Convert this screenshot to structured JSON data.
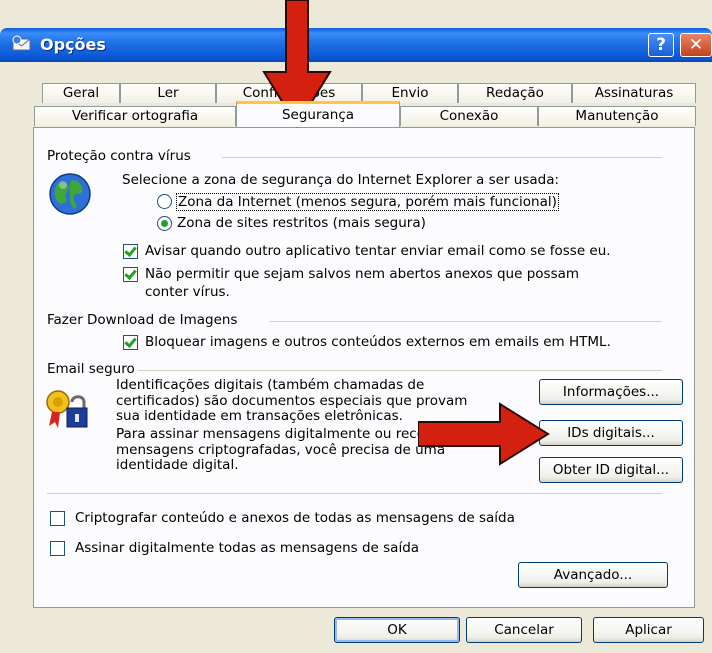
{
  "window": {
    "title": "Opções"
  },
  "tabs_row1": [
    "Geral",
    "Ler",
    "Confirmações",
    "Envio",
    "Redação",
    "Assinaturas"
  ],
  "tabs_row2": [
    "Verificar ortografia",
    "Segurança",
    "Conexão",
    "Manutenção"
  ],
  "active_tab": "Segurança",
  "virus": {
    "group_label": "Proteção contra vírus",
    "zone_prompt": "Selecione a zona de segurança do Internet Explorer a ser usada:",
    "zone_internet": "Zona da Internet (menos segura, porém mais funcional)",
    "zone_restricted": "Zona de sites restritos (mais segura)",
    "selected_zone": "restricted",
    "warn_label": "Avisar quando outro aplicativo tentar enviar email como se fosse eu.",
    "warn_checked": true,
    "block_attach_line1": "Não permitir que sejam salvos nem abertos anexos que possam",
    "block_attach_line2": "conter vírus.",
    "block_attach_checked": true
  },
  "images": {
    "group_label": "Fazer Download de Imagens",
    "block_images_label": "Bloquear imagens e outros conteúdos externos em emails em HTML.",
    "block_images_checked": true
  },
  "secure_email": {
    "group_label": "Email seguro",
    "desc1_l1": "Identificações digitais (também chamadas de",
    "desc1_l2": "certificados) são documentos especiais que provam",
    "desc1_l3": "sua identidade em transações eletrônicas.",
    "desc2_l1": "Para assinar mensagens digitalmente ou receber",
    "desc2_l2": "mensagens criptografadas, você precisa de uma",
    "desc2_l3": "identidade digital.",
    "info_button": "Informações...",
    "ids_button": "IDs digitais...",
    "get_id_button": "Obter ID digital...",
    "encrypt_label": "Criptografar conteúdo e anexos de todas as mensagens de saída",
    "encrypt_checked": false,
    "sign_label": "Assinar digitalmente todas as mensagens de saída",
    "sign_checked": false,
    "advanced_button": "Avançado..."
  },
  "footer": {
    "ok": "OK",
    "cancel": "Cancelar",
    "apply": "Aplicar"
  },
  "colors": {
    "arrow": "#d3200f",
    "titlebar": "#1f6fe6",
    "active_tab_accent": "#ffc83c"
  }
}
